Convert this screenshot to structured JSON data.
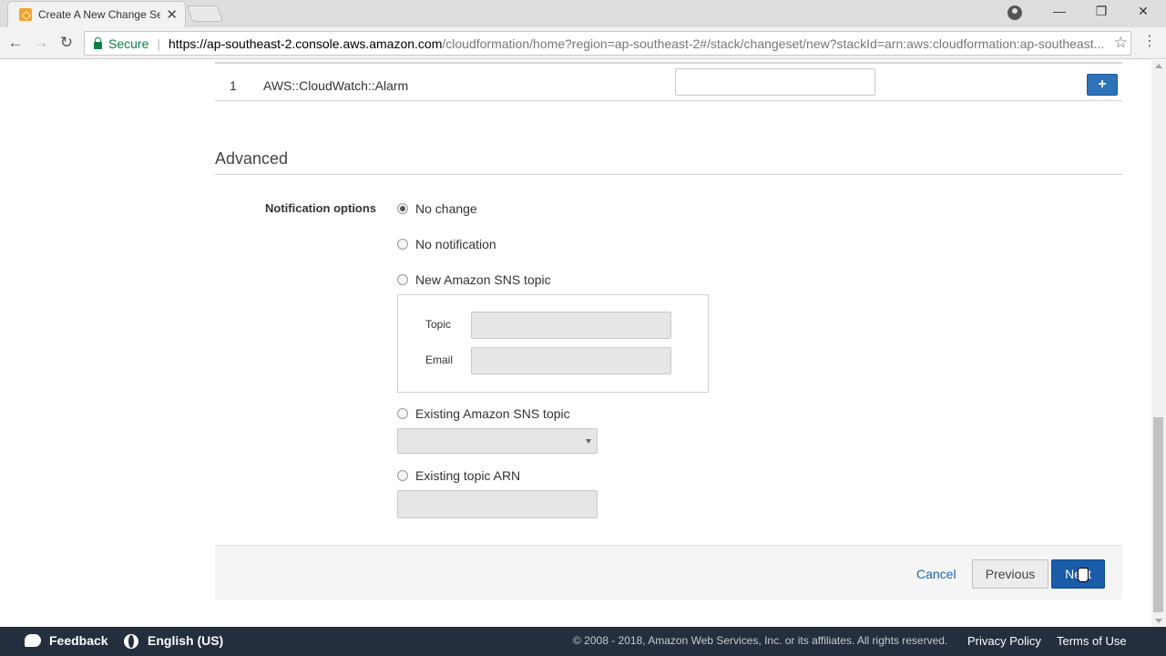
{
  "browser": {
    "tab_title": "Create A New Change Se",
    "tab_close": "✕",
    "win_minimize": "—",
    "win_restore": "❐",
    "win_close": "✕",
    "back": "←",
    "forward": "→",
    "reload": "↻",
    "secure_label": "Secure",
    "separator": "|",
    "url_host": "https://ap-southeast-2.console.aws.amazon.com",
    "url_path": "/cloudformation/home?region=ap-southeast-2#/stack/changeset/new?stackId=arn:aws:cloudformation:ap-southeast...",
    "star": "☆",
    "menu": "⋮"
  },
  "resources_table": {
    "rows": [
      {
        "index": "1",
        "type": "AWS::CloudWatch::Alarm",
        "add_label": "+"
      }
    ]
  },
  "advanced": {
    "title": "Advanced",
    "notification_label": "Notification options",
    "options": [
      {
        "label": "No change",
        "selected": true
      },
      {
        "label": "No notification",
        "selected": false
      },
      {
        "label": "New Amazon SNS topic",
        "selected": false
      },
      {
        "label": "Existing Amazon SNS topic",
        "selected": false
      },
      {
        "label": "Existing topic ARN",
        "selected": false
      }
    ],
    "sns_topic_label": "Topic",
    "sns_email_label": "Email"
  },
  "actions": {
    "cancel": "Cancel",
    "previous": "Previous",
    "next": "Next"
  },
  "footer": {
    "feedback": "Feedback",
    "language": "English (US)",
    "copyright": "© 2008 - 2018, Amazon Web Services, Inc. or its affiliates. All rights reserved.",
    "privacy": "Privacy Policy",
    "terms": "Terms of Use"
  }
}
